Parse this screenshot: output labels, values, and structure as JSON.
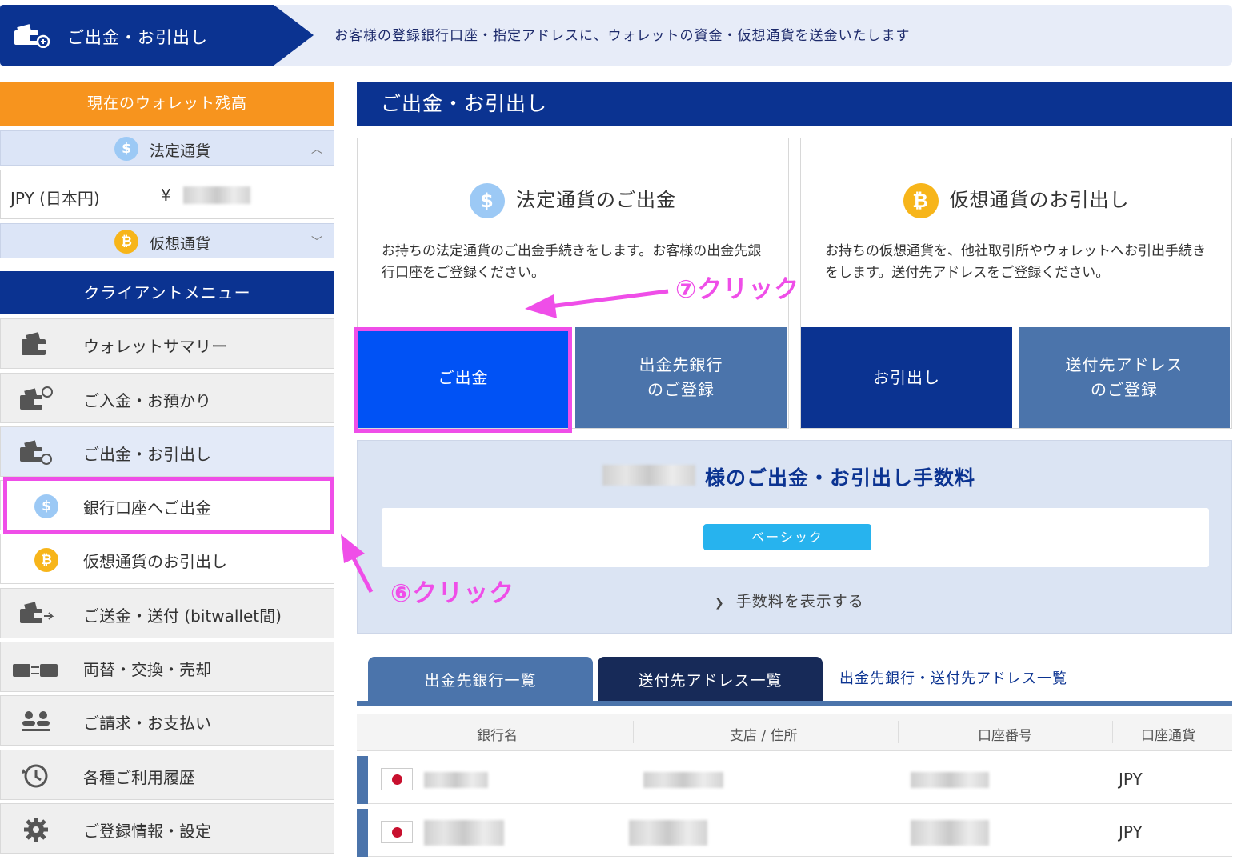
{
  "header": {
    "title": "ご出金・お引出し",
    "description": "お客様の登録銀行口座・指定アドレスに、ウォレットの資金・仮想通貨を送金いたします"
  },
  "sidebar": {
    "balance_heading": "現在のウォレット残高",
    "fiat_label": "法定通貨",
    "jpy_label": "JPY (日本円)",
    "yen_symbol": "¥",
    "crypto_label": "仮想通貨",
    "menu_heading": "クライアントメニュー",
    "items": [
      {
        "label": "ウォレットサマリー",
        "icon": "wallet-icon"
      },
      {
        "label": "ご入金・お預かり",
        "icon": "wallet-deposit-icon"
      },
      {
        "label": "ご出金・お引出し",
        "icon": "wallet-withdraw-icon"
      },
      {
        "label": "銀行口座へご出金",
        "icon": "dollar-coin-icon"
      },
      {
        "label": "仮想通貨のお引出し",
        "icon": "bitcoin-coin-icon"
      },
      {
        "label": "ご送金・送付 (bitwallet間)",
        "icon": "wallet-transfer-icon"
      },
      {
        "label": "両替・交換・売却",
        "icon": "exchange-icon"
      },
      {
        "label": "ご請求・お支払い",
        "icon": "users-icon"
      },
      {
        "label": "各種ご利用履歴",
        "icon": "history-icon"
      },
      {
        "label": "ご登録情報・設定",
        "icon": "gear-icon"
      }
    ]
  },
  "main": {
    "heading": "ご出金・お引出し",
    "fiat_card": {
      "title": "法定通貨のご出金",
      "desc": "お持ちの法定通貨のご出金手続きをします。お客様の出金先銀行口座をご登録ください。",
      "btn_withdraw": "ご出金",
      "btn_register_line1": "出金先銀行",
      "btn_register_line2": "のご登録"
    },
    "crypto_card": {
      "title": "仮想通貨のお引出し",
      "desc": "お持ちの仮想通貨を、他社取引所やウォレットへお引出手続きをします。送付先アドレスをご登録ください。",
      "btn_withdraw": "お引出し",
      "btn_register_line1": "送付先アドレス",
      "btn_register_line2": "のご登録"
    },
    "fee": {
      "title": "様のご出金・お引出し手数料",
      "badge": "ベーシック",
      "toggle": "手数料を表示する"
    },
    "tabs": {
      "bank_list": "出金先銀行一覧",
      "address_list": "送付先アドレス一覧",
      "combined_link": "出金先銀行・送付先アドレス一覧"
    },
    "table": {
      "headers": [
        "銀行名",
        "支店 / 住所",
        "口座番号",
        "口座通貨"
      ],
      "rows": [
        {
          "currency": "JPY"
        },
        {
          "currency": "JPY"
        }
      ]
    }
  },
  "annotations": {
    "step7": "⑦クリック",
    "step6": "⑥クリック",
    "color": "#ef4ee8"
  },
  "colors": {
    "navy": "#0b3391",
    "orange": "#f7941e",
    "primary_blue": "#0052f5",
    "steel_blue": "#4b74ab",
    "badge_cyan": "#27b3ee"
  }
}
